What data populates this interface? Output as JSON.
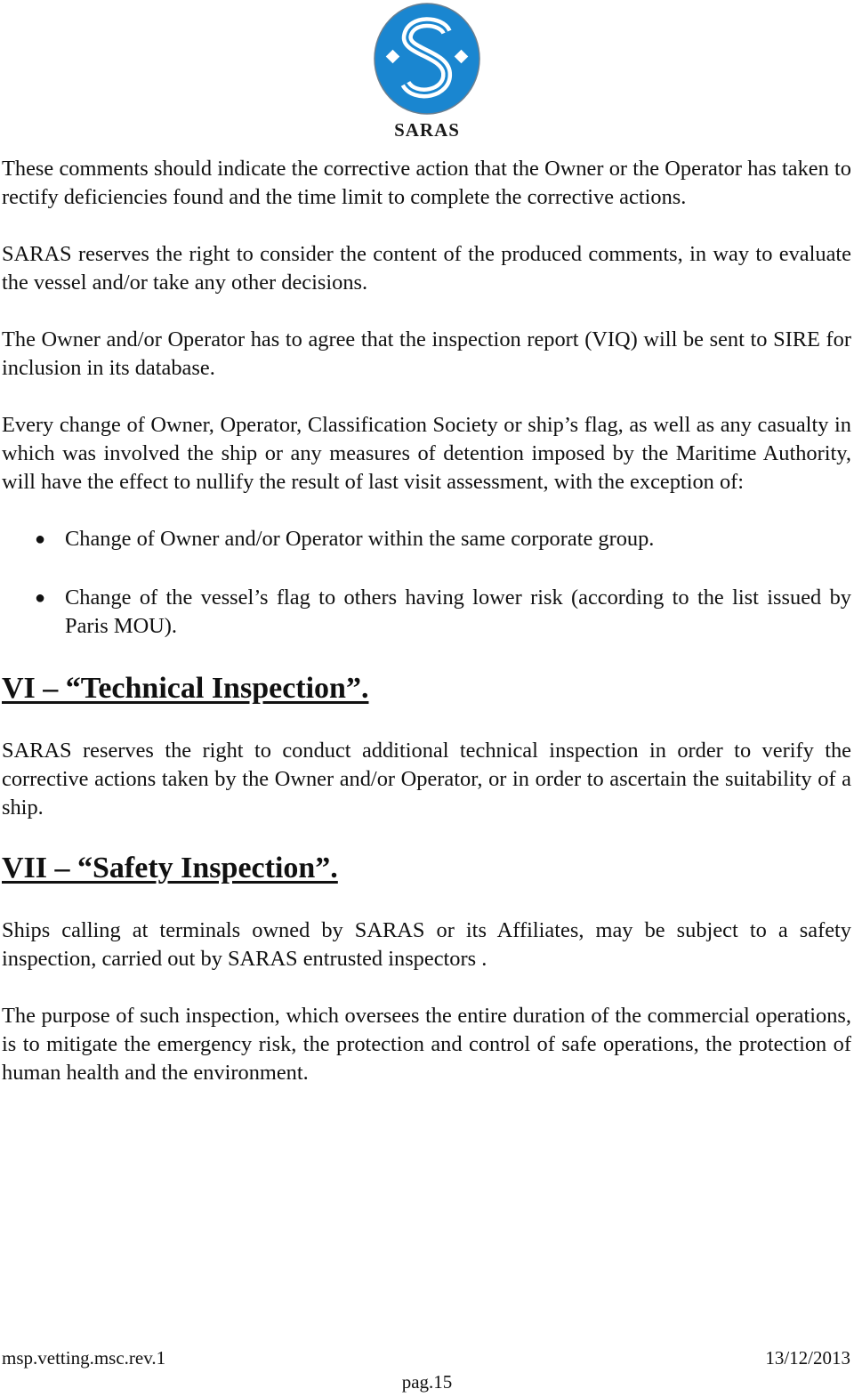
{
  "logo": {
    "icon": "saras-s-logo-icon",
    "text": "SARAS",
    "colors": {
      "circle": "#1a86d0",
      "mark": "#ffffff"
    }
  },
  "paragraphs_top": [
    "These comments should indicate the corrective action that the Owner or the Operator has taken to rectify deficiencies found and the time limit to complete the corrective actions.",
    "SARAS reserves the right to consider the content of the produced comments, in way to evaluate the vessel and/or take any other decisions.",
    "The Owner and/or Operator has to agree that the inspection report (VIQ) will be sent to SIRE for inclusion in its database.",
    "Every change of Owner, Operator, Classification Society or ship’s flag, as well as any casualty in which was involved the ship or any measures of detention imposed by the Maritime Authority, will have the effect to nullify the result of last visit assessment, with the exception of:"
  ],
  "bullets": {
    "marker": "●",
    "items": [
      "Change of Owner and/or Operator within the same corporate group.",
      "Change of the vessel’s flag to others having lower risk (according to the list issued by Paris MOU)."
    ]
  },
  "sections": [
    {
      "heading": "VI – “Technical Inspection”.",
      "paragraphs": [
        "SARAS reserves the right to conduct additional technical inspection in order to verify the corrective actions taken by the Owner and/or Operator, or in order to ascertain the suitability of a ship."
      ]
    },
    {
      "heading": "VII – “Safety Inspection”.",
      "paragraphs": [
        "Ships calling at terminals owned by SARAS or its Affiliates, may be subject to a safety inspection, carried out by SARAS entrusted inspectors .",
        "The purpose of such inspection, which oversees the entire duration of the commercial operations, is to mitigate the emergency risk, the protection and control of safe operations, the protection of human health and the environment."
      ]
    }
  ],
  "footer": {
    "doc_code": "msp.vetting.msc.rev.1",
    "date": "13/12/2013",
    "page": "pag.15"
  }
}
